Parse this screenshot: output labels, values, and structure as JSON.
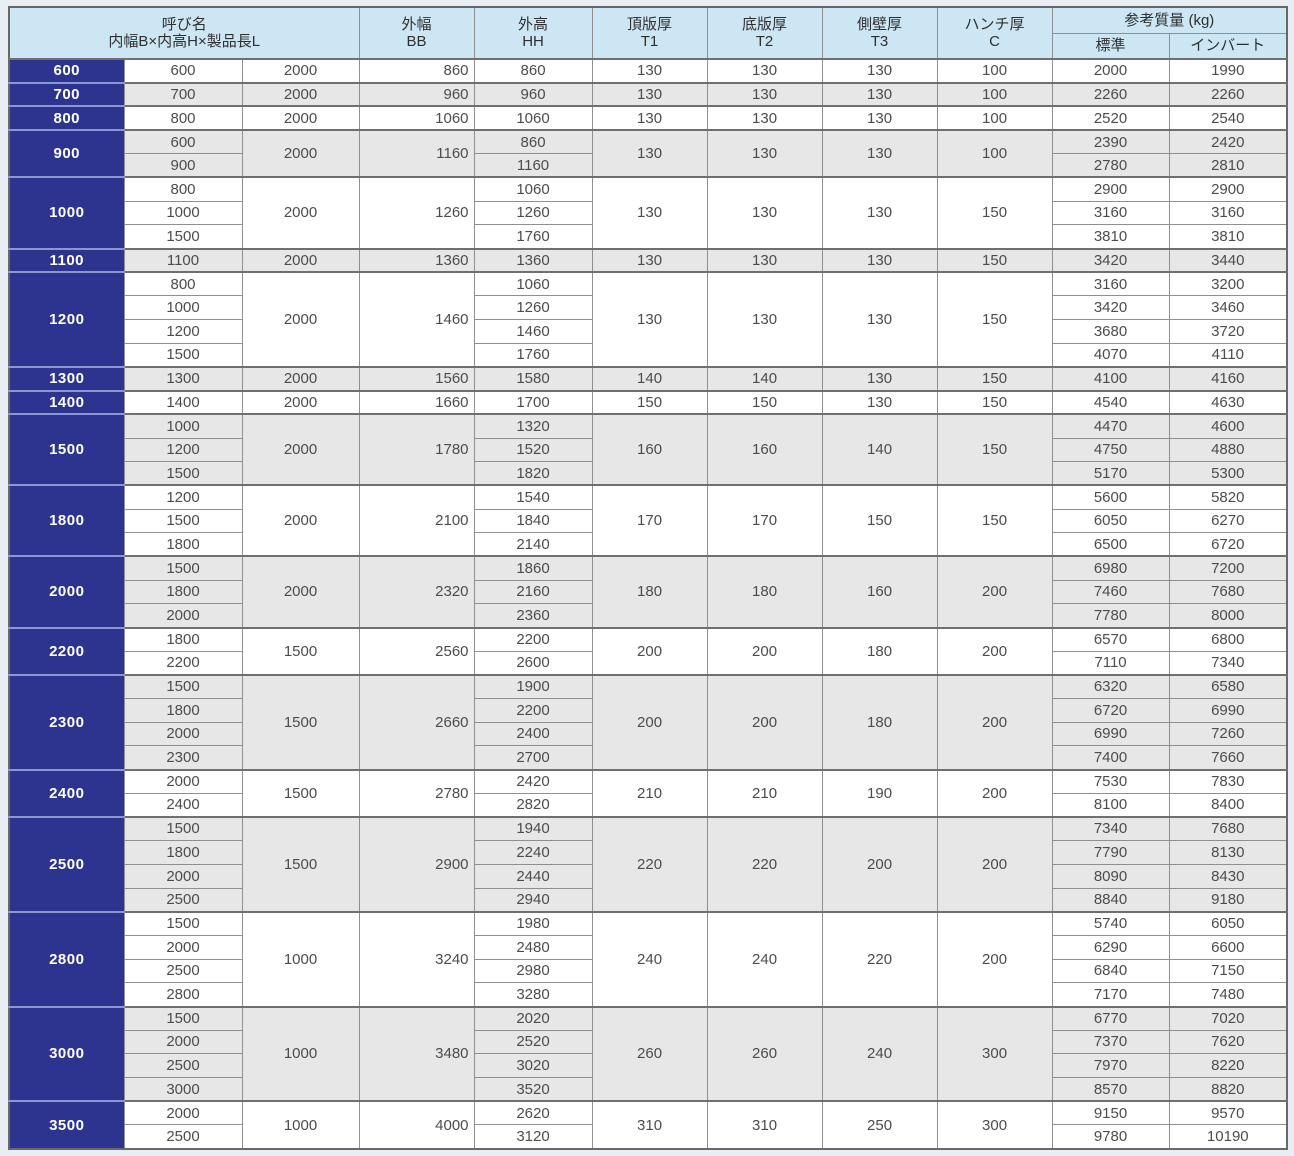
{
  "colors": {
    "navy": "#2d3490",
    "navy-sep": "#8d97cf",
    "header-blue": "#cde6f4",
    "stripe": "#e7e7e7",
    "page-bg": "#e8eef4"
  },
  "header": {
    "name_col": {
      "line1": "呼び名",
      "line2": "内幅B×内高H×製品長L"
    },
    "cols": [
      {
        "line1": "外幅",
        "line2": "BB"
      },
      {
        "line1": "外高",
        "line2": "HH"
      },
      {
        "line1": "頂版厚",
        "line2": "T1"
      },
      {
        "line1": "底版厚",
        "line2": "T2"
      },
      {
        "line1": "側壁厚",
        "line2": "T3"
      },
      {
        "line1": "ハンチ厚",
        "line2": "C"
      }
    ],
    "mass": {
      "title": "参考質量 (kg)",
      "sub_standard": "標準",
      "sub_invert": "インバート"
    }
  },
  "table": {
    "groups": [
      {
        "name": "600",
        "L": "2000",
        "BB": "860",
        "T1": "130",
        "T2": "130",
        "T3": "130",
        "C": "100",
        "rows": [
          {
            "H": "600",
            "HH": "860",
            "std": "2000",
            "inv": "1990"
          }
        ]
      },
      {
        "name": "700",
        "L": "2000",
        "BB": "960",
        "T1": "130",
        "T2": "130",
        "T3": "130",
        "C": "100",
        "rows": [
          {
            "H": "700",
            "HH": "960",
            "std": "2260",
            "inv": "2260"
          }
        ]
      },
      {
        "name": "800",
        "L": "2000",
        "BB": "1060",
        "T1": "130",
        "T2": "130",
        "T3": "130",
        "C": "100",
        "rows": [
          {
            "H": "800",
            "HH": "1060",
            "std": "2520",
            "inv": "2540"
          }
        ]
      },
      {
        "name": "900",
        "L": "2000",
        "BB": "1160",
        "T1": "130",
        "T2": "130",
        "T3": "130",
        "C": "100",
        "rows": [
          {
            "H": "600",
            "HH": "860",
            "std": "2390",
            "inv": "2420"
          },
          {
            "H": "900",
            "HH": "1160",
            "std": "2780",
            "inv": "2810"
          }
        ]
      },
      {
        "name": "1000",
        "L": "2000",
        "BB": "1260",
        "T1": "130",
        "T2": "130",
        "T3": "130",
        "C": "150",
        "rows": [
          {
            "H": "800",
            "HH": "1060",
            "std": "2900",
            "inv": "2900"
          },
          {
            "H": "1000",
            "HH": "1260",
            "std": "3160",
            "inv": "3160"
          },
          {
            "H": "1500",
            "HH": "1760",
            "std": "3810",
            "inv": "3810"
          }
        ]
      },
      {
        "name": "1100",
        "L": "2000",
        "BB": "1360",
        "T1": "130",
        "T2": "130",
        "T3": "130",
        "C": "150",
        "rows": [
          {
            "H": "1100",
            "HH": "1360",
            "std": "3420",
            "inv": "3440"
          }
        ]
      },
      {
        "name": "1200",
        "L": "2000",
        "BB": "1460",
        "T1": "130",
        "T2": "130",
        "T3": "130",
        "C": "150",
        "rows": [
          {
            "H": "800",
            "HH": "1060",
            "std": "3160",
            "inv": "3200"
          },
          {
            "H": "1000",
            "HH": "1260",
            "std": "3420",
            "inv": "3460"
          },
          {
            "H": "1200",
            "HH": "1460",
            "std": "3680",
            "inv": "3720"
          },
          {
            "H": "1500",
            "HH": "1760",
            "std": "4070",
            "inv": "4110"
          }
        ]
      },
      {
        "name": "1300",
        "L": "2000",
        "BB": "1560",
        "T1": "140",
        "T2": "140",
        "T3": "130",
        "C": "150",
        "rows": [
          {
            "H": "1300",
            "HH": "1580",
            "std": "4100",
            "inv": "4160"
          }
        ]
      },
      {
        "name": "1400",
        "L": "2000",
        "BB": "1660",
        "T1": "150",
        "T2": "150",
        "T3": "130",
        "C": "150",
        "rows": [
          {
            "H": "1400",
            "HH": "1700",
            "std": "4540",
            "inv": "4630"
          }
        ]
      },
      {
        "name": "1500",
        "L": "2000",
        "BB": "1780",
        "T1": "160",
        "T2": "160",
        "T3": "140",
        "C": "150",
        "rows": [
          {
            "H": "1000",
            "HH": "1320",
            "std": "4470",
            "inv": "4600"
          },
          {
            "H": "1200",
            "HH": "1520",
            "std": "4750",
            "inv": "4880"
          },
          {
            "H": "1500",
            "HH": "1820",
            "std": "5170",
            "inv": "5300"
          }
        ]
      },
      {
        "name": "1800",
        "L": "2000",
        "BB": "2100",
        "T1": "170",
        "T2": "170",
        "T3": "150",
        "C": "150",
        "rows": [
          {
            "H": "1200",
            "HH": "1540",
            "std": "5600",
            "inv": "5820"
          },
          {
            "H": "1500",
            "HH": "1840",
            "std": "6050",
            "inv": "6270"
          },
          {
            "H": "1800",
            "HH": "2140",
            "std": "6500",
            "inv": "6720"
          }
        ]
      },
      {
        "name": "2000",
        "L": "2000",
        "BB": "2320",
        "T1": "180",
        "T2": "180",
        "T3": "160",
        "C": "200",
        "rows": [
          {
            "H": "1500",
            "HH": "1860",
            "std": "6980",
            "inv": "7200"
          },
          {
            "H": "1800",
            "HH": "2160",
            "std": "7460",
            "inv": "7680"
          },
          {
            "H": "2000",
            "HH": "2360",
            "std": "7780",
            "inv": "8000"
          }
        ]
      },
      {
        "name": "2200",
        "L": "1500",
        "BB": "2560",
        "T1": "200",
        "T2": "200",
        "T3": "180",
        "C": "200",
        "rows": [
          {
            "H": "1800",
            "HH": "2200",
            "std": "6570",
            "inv": "6800"
          },
          {
            "H": "2200",
            "HH": "2600",
            "std": "7110",
            "inv": "7340"
          }
        ]
      },
      {
        "name": "2300",
        "L": "1500",
        "BB": "2660",
        "T1": "200",
        "T2": "200",
        "T3": "180",
        "C": "200",
        "rows": [
          {
            "H": "1500",
            "HH": "1900",
            "std": "6320",
            "inv": "6580"
          },
          {
            "H": "1800",
            "HH": "2200",
            "std": "6720",
            "inv": "6990"
          },
          {
            "H": "2000",
            "HH": "2400",
            "std": "6990",
            "inv": "7260"
          },
          {
            "H": "2300",
            "HH": "2700",
            "std": "7400",
            "inv": "7660"
          }
        ]
      },
      {
        "name": "2400",
        "L": "1500",
        "BB": "2780",
        "T1": "210",
        "T2": "210",
        "T3": "190",
        "C": "200",
        "rows": [
          {
            "H": "2000",
            "HH": "2420",
            "std": "7530",
            "inv": "7830"
          },
          {
            "H": "2400",
            "HH": "2820",
            "std": "8100",
            "inv": "8400"
          }
        ]
      },
      {
        "name": "2500",
        "L": "1500",
        "BB": "2900",
        "T1": "220",
        "T2": "220",
        "T3": "200",
        "C": "200",
        "rows": [
          {
            "H": "1500",
            "HH": "1940",
            "std": "7340",
            "inv": "7680"
          },
          {
            "H": "1800",
            "HH": "2240",
            "std": "7790",
            "inv": "8130"
          },
          {
            "H": "2000",
            "HH": "2440",
            "std": "8090",
            "inv": "8430"
          },
          {
            "H": "2500",
            "HH": "2940",
            "std": "8840",
            "inv": "9180"
          }
        ]
      },
      {
        "name": "2800",
        "L": "1000",
        "BB": "3240",
        "T1": "240",
        "T2": "240",
        "T3": "220",
        "C": "200",
        "rows": [
          {
            "H": "1500",
            "HH": "1980",
            "std": "5740",
            "inv": "6050"
          },
          {
            "H": "2000",
            "HH": "2480",
            "std": "6290",
            "inv": "6600"
          },
          {
            "H": "2500",
            "HH": "2980",
            "std": "6840",
            "inv": "7150"
          },
          {
            "H": "2800",
            "HH": "3280",
            "std": "7170",
            "inv": "7480"
          }
        ]
      },
      {
        "name": "3000",
        "L": "1000",
        "BB": "3480",
        "T1": "260",
        "T2": "260",
        "T3": "240",
        "C": "300",
        "rows": [
          {
            "H": "1500",
            "HH": "2020",
            "std": "6770",
            "inv": "7020"
          },
          {
            "H": "2000",
            "HH": "2520",
            "std": "7370",
            "inv": "7620"
          },
          {
            "H": "2500",
            "HH": "3020",
            "std": "7970",
            "inv": "8220"
          },
          {
            "H": "3000",
            "HH": "3520",
            "std": "8570",
            "inv": "8820"
          }
        ]
      },
      {
        "name": "3500",
        "L": "1000",
        "BB": "4000",
        "T1": "310",
        "T2": "310",
        "T3": "250",
        "C": "300",
        "rows": [
          {
            "H": "2000",
            "HH": "2620",
            "std": "9150",
            "inv": "9570"
          },
          {
            "H": "2500",
            "HH": "3120",
            "std": "9780",
            "inv": "10190"
          }
        ]
      }
    ]
  }
}
